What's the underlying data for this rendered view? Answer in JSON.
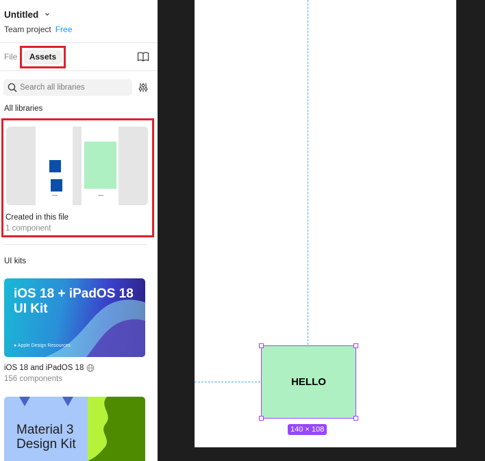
{
  "file": {
    "title": "Untitled",
    "team": "Team project",
    "plan": "Free"
  },
  "tabs": {
    "file_label": "File",
    "assets_label": "Assets"
  },
  "search": {
    "placeholder": "Search all libraries"
  },
  "sections": {
    "all_libraries": "All libraries",
    "ui_kits": "UI kits"
  },
  "local_library": {
    "name": "Created in this file",
    "meta": "1 component"
  },
  "ui_kits": [
    {
      "thumb_title_line1": "iOS 18 + iPadOS 18",
      "thumb_title_line2": "UI Kit",
      "thumb_footer": "Apple Design Resources",
      "name": "iOS 18 and iPadOS 18",
      "meta": "156 components"
    },
    {
      "thumb_title_line1": "Material 3",
      "thumb_title_line2": "Design Kit"
    }
  ],
  "canvas": {
    "box_label": "HELLO",
    "size_label": "140 × 108"
  },
  "colors": {
    "accent_red": "#e0202b",
    "selection": "#9747ff",
    "box_fill": "#aef0c1",
    "link_blue": "#0d99ff",
    "canvas_bg": "#1e1e1e"
  }
}
